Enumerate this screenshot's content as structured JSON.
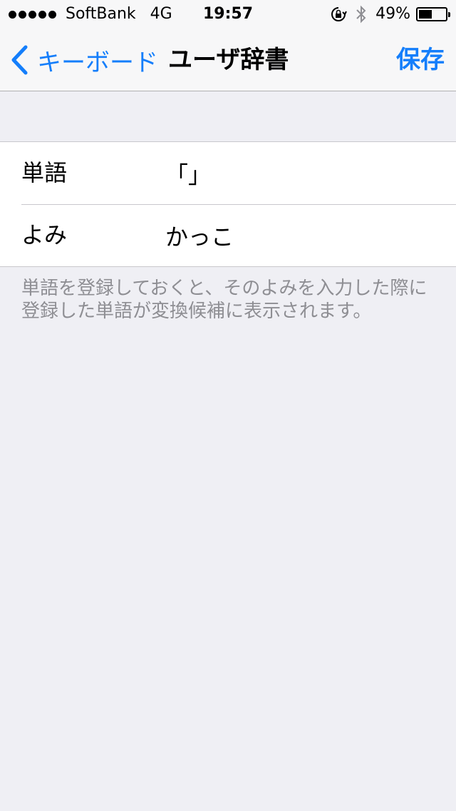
{
  "status_bar": {
    "carrier": "SoftBank",
    "network": "4G",
    "time": "19:57",
    "battery_percent_label": "49%",
    "battery_level": 0.49,
    "icons": [
      "signal-dots-icon",
      "rotation-lock-icon",
      "bluetooth-icon",
      "battery-icon"
    ]
  },
  "nav": {
    "back_label": "キーボード",
    "title": "ユーザ辞書",
    "save_label": "保存"
  },
  "form": {
    "word_label": "単語",
    "word_value": "「」",
    "reading_label": "よみ",
    "reading_value": "かっこ"
  },
  "footer": {
    "note": "単語を登録しておくと、そのよみを入力した際に登録した単語が変換候補に表示されます。"
  },
  "colors": {
    "accent": "#147efb",
    "background": "#efeff4",
    "footer_text": "#8e8e93"
  }
}
